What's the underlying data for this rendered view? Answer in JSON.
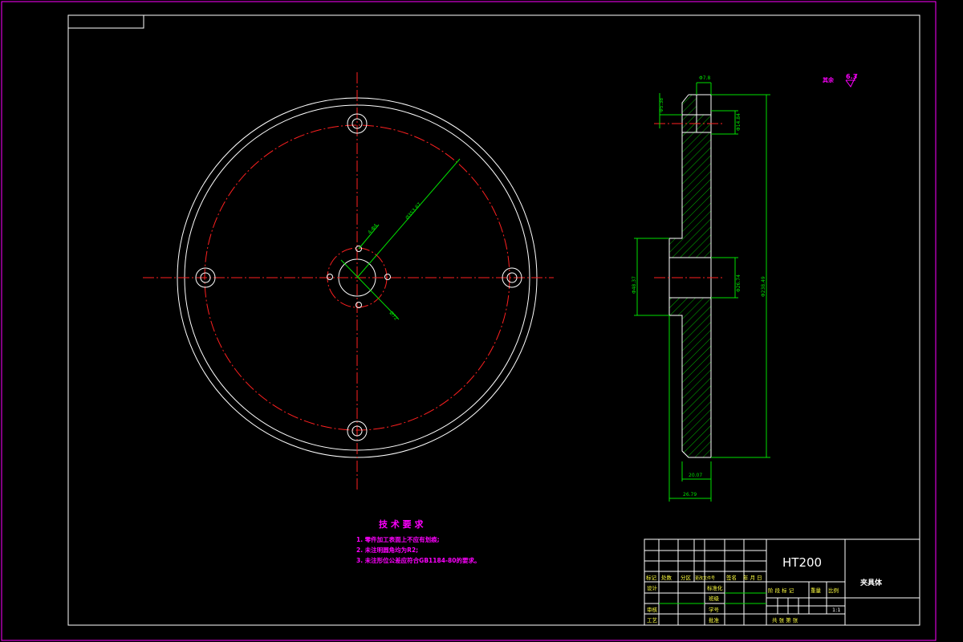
{
  "dims": {
    "bolt_circle_dia": "Ø353.67",
    "hole_pattern": "4-Φ4",
    "center_bore": "Ø72",
    "hub_bore_left": "Φ5.38",
    "hub_width_top": "Φ14.84",
    "top_step": "Φ7.8",
    "hub_dia": "Φ48.37",
    "bore_dia": "Φ26.74",
    "overall_dia": "Φ238.49",
    "flange_thickness": "20.07",
    "total_thickness": "26.79"
  },
  "roughness": {
    "label": "其余",
    "value": "6.3"
  },
  "tech_req": {
    "title": "技 术 要 求",
    "items": [
      "1. 零件加工表面上不应有划痕;",
      "2. 未注明圆角均为R2;",
      "3. 未注形位公差应符合GB1184-80的要求。"
    ]
  },
  "title_block": {
    "material": "HT200",
    "part_name": "夹具体",
    "col_headers": [
      "标记",
      "处数",
      "分区",
      "更改文件号",
      "签名",
      "年 月 日"
    ],
    "row_labels": [
      "设计",
      "审核",
      "工艺"
    ],
    "mid_labels": [
      "标准化",
      "班级",
      "学号",
      "批准"
    ],
    "stage_headers": [
      "阶 段 标 记",
      "重量",
      "比例"
    ],
    "scale": "1:1",
    "sheet_text": "共    张  第    张"
  }
}
